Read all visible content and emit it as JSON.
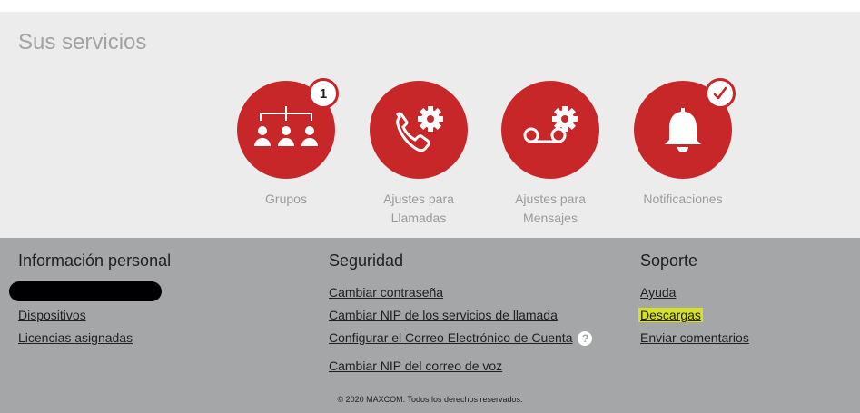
{
  "services": {
    "title": "Sus servicios",
    "items": [
      {
        "label_line1": "Grupos",
        "label_line2": "",
        "icon": "groups-icon",
        "badge": "1"
      },
      {
        "label_line1": "Ajustes para",
        "label_line2": "Llamadas",
        "icon": "phone-settings-icon",
        "badge": ""
      },
      {
        "label_line1": "Ajustes para",
        "label_line2": "Mensajes",
        "icon": "voicemail-settings-icon",
        "badge": ""
      },
      {
        "label_line1": "Notificaciones",
        "label_line2": "",
        "icon": "bell-icon",
        "badge": "check-icon"
      }
    ]
  },
  "footer": {
    "personal": {
      "title": "Información personal",
      "links": [
        "Dispositivos",
        "Licencias asignadas"
      ]
    },
    "security": {
      "title": "Seguridad",
      "links": [
        "Cambiar contraseña",
        "Cambiar NIP de los servicios de llamada",
        "Configurar el Correo Electrónico de Cuenta",
        "Cambiar NIP del correo de voz"
      ],
      "help_glyph": "?"
    },
    "support": {
      "title": "Soporte",
      "links": [
        "Ayuda",
        "Descargas",
        "Enviar comentarios"
      ]
    },
    "copyright": "© 2020 MAXCOM. Todos los derechos reservados."
  },
  "colors": {
    "brand_red": "#c8272a",
    "services_bg": "#ececec",
    "footer_bg": "#a5a6a8",
    "highlight": "#d4e02a"
  }
}
